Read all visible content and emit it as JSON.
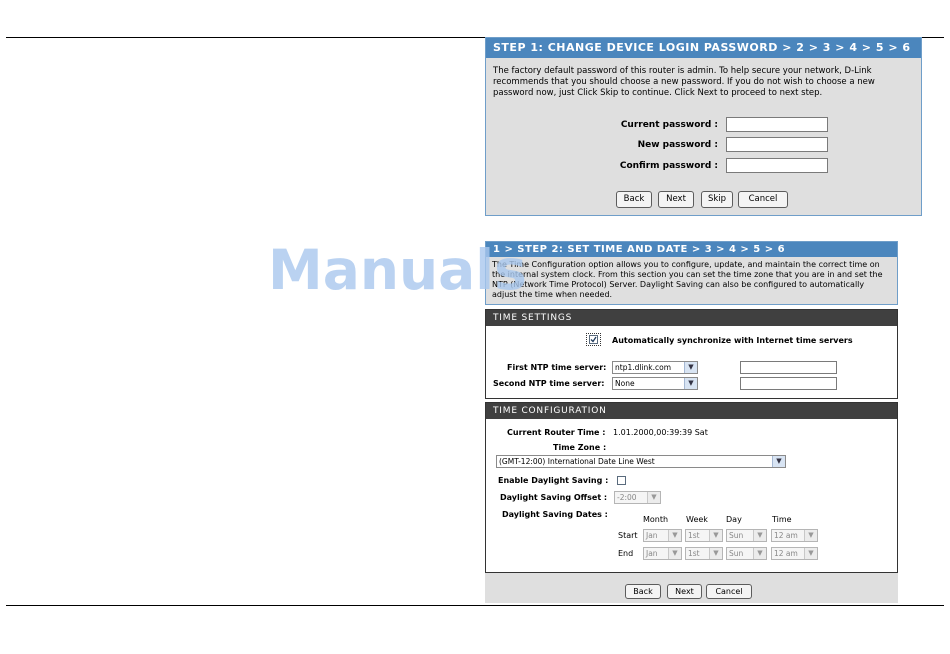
{
  "watermark": "Manuals",
  "step1": {
    "title": "STEP 1: CHANGE DEVICE LOGIN PASSWORD > 2 > 3 > 4 > 5 > 6",
    "description": "The factory default password of this router is admin. To help secure your network, D-Link recommends that you should choose a new password. If you do not wish to choose a new password now, just Click Skip to continue. Click Next to proceed to next step.",
    "current_password_label": "Current password :",
    "new_password_label": "New password :",
    "confirm_password_label": "Confirm password :",
    "buttons": {
      "back": "Back",
      "next": "Next",
      "skip": "Skip",
      "cancel": "Cancel"
    }
  },
  "step2": {
    "title": "1 > STEP 2: SET TIME AND DATE > 3 > 4 > 5 > 6",
    "description": "The Time Configuration option allows you to configure, update, and maintain the correct time on the internal system clock. From this section you can set the time zone that you are in and set the NTP (Network Time Protocol) Server. Daylight Saving can also be configured to automatically adjust the time when needed."
  },
  "time_settings": {
    "header": "TIME SETTINGS",
    "auto_sync_label": "Automatically synchronize with Internet time servers",
    "auto_sync_checked": true,
    "first_ntp_label": "First NTP time server:",
    "first_ntp_value": "ntp1.dlink.com",
    "second_ntp_label": "Second NTP time server:",
    "second_ntp_value": "None"
  },
  "time_config": {
    "header": "TIME CONFIGURATION",
    "current_time_label": "Current Router Time :",
    "current_time_value": "1.01.2000,00:39:39 Sat",
    "time_zone_label": "Time Zone :",
    "time_zone_value": "(GMT-12:00) International Date Line West",
    "daylight_label": "Enable Daylight Saving :",
    "offset_label": "Daylight Saving Offset :",
    "offset_value": "-2:00",
    "dates_label": "Daylight Saving Dates :",
    "col_month": "Month",
    "col_week": "Week",
    "col_day": "Day",
    "col_time": "Time",
    "start_label": "Start",
    "end_label": "End",
    "start": {
      "month": "Jan",
      "week": "1st",
      "day": "Sun",
      "time": "12 am"
    },
    "end": {
      "month": "Jan",
      "week": "1st",
      "day": "Sun",
      "time": "12 am"
    }
  },
  "bottom_buttons": {
    "back": "Back",
    "next": "Next",
    "cancel": "Cancel"
  },
  "icons": {
    "dropdown": "chevron-down-icon",
    "check": "check-icon"
  }
}
